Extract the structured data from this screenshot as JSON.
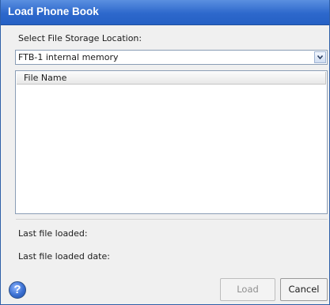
{
  "window": {
    "title": "Load Phone Book"
  },
  "storage": {
    "label": "Select File Storage Location:",
    "selected": "FTB-1 internal memory"
  },
  "file_list": {
    "columns": [
      "File Name"
    ],
    "rows": []
  },
  "status": {
    "last_file_loaded_label": "Last file loaded:",
    "last_file_loaded_value": "",
    "last_file_loaded_date_label": "Last file loaded date:",
    "last_file_loaded_date_value": ""
  },
  "footer": {
    "help_icon": "question-mark-icon",
    "help_glyph": "?",
    "load_label": "Load",
    "cancel_label": "Cancel"
  },
  "colors": {
    "titlebar": "#2d68cc",
    "dialog_bg": "#f0f0f0",
    "disabled_text": "#8f8f8f"
  }
}
